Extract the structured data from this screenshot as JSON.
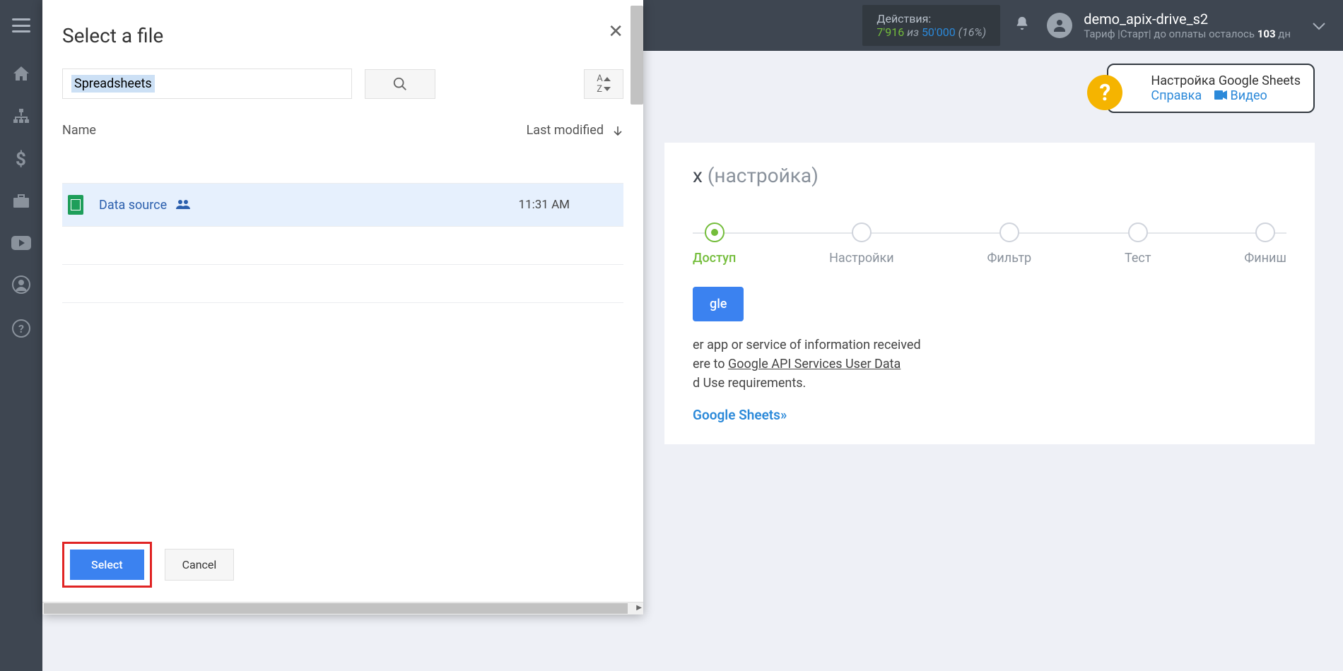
{
  "topbar": {
    "actions_title": "Действия:",
    "actions_used": "7'916",
    "actions_of_word": "из",
    "actions_limit": "50'000",
    "actions_pct": "(16%)",
    "user_name": "demo_apix-drive_s2",
    "tariff_prefix": "Тариф |Старт|  до оплаты осталось ",
    "tariff_days": "103",
    "tariff_suffix": " дн"
  },
  "help": {
    "title": "Настройка Google Sheets",
    "link1": "Справка",
    "link2": "Видео"
  },
  "card": {
    "title_tail": "х",
    "title_suffix": "(настройка)",
    "steps": [
      "Доступ",
      "Настройки",
      "Фильтр",
      "Тест",
      "Финиш"
    ],
    "google_btn_tail": "gle",
    "disclosure_line1": "er app or service of information received",
    "disclosure_line2_a": "ere to ",
    "disclosure_link": "Google API Services User Data",
    "disclosure_line3": "d Use requirements.",
    "instruction_tail": "Google Sheets»"
  },
  "picker": {
    "title": "Select a file",
    "search_chip": "Spreadsheets",
    "col_name": "Name",
    "col_modified": "Last modified",
    "file_name": "Data source",
    "file_time": "11:31 AM",
    "btn_select": "Select",
    "btn_cancel": "Cancel"
  }
}
